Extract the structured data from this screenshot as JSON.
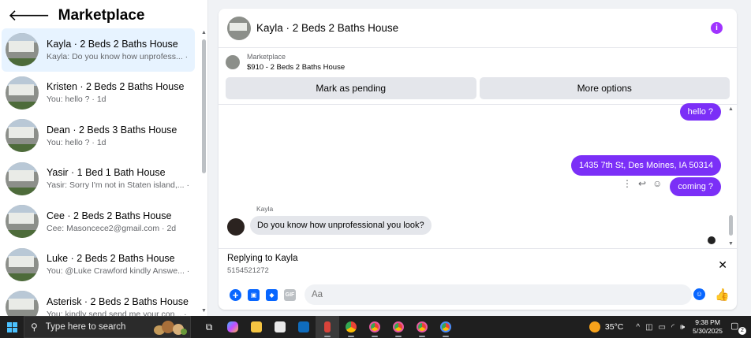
{
  "sidebar": {
    "title": "Marketplace",
    "conversations": [
      {
        "title": "Kayla · 2 Beds 2 Baths House",
        "preview": "Kayla: Do you know how unprofess... · 2h"
      },
      {
        "title": "Kristen · 2 Beds 2 Baths House",
        "preview": "You: hello ? · 1d"
      },
      {
        "title": "Dean · 2 Beds 3 Baths House",
        "preview": "You: hello ? · 1d"
      },
      {
        "title": "Yasir · 1 Bed 1 Bath House",
        "preview": "Yasir: Sorry I'm not in Staten island,... · 1d"
      },
      {
        "title": "Cee · 2 Beds 2 Baths House",
        "preview": "Cee: Masoncece2@gmail.com · 2d"
      },
      {
        "title": "Luke · 2 Beds 2 Baths House",
        "preview": "You: @Luke Crawford kindly Answe... · 6d"
      },
      {
        "title": "Asterisk · 2 Beds 2 Baths House",
        "preview": "You: kindly send send me your con... · 1w"
      }
    ]
  },
  "chat": {
    "title": "Kayla · 2 Beds 2 Baths House",
    "listing": {
      "label": "Marketplace",
      "price_line": "$910 - 2 Beds 2 Baths House"
    },
    "buttons": {
      "mark_pending": "Mark as pending",
      "more_options": "More options"
    },
    "messages": {
      "out_1": "hello ?",
      "out_2": "1435 7th St, Des Moines, IA 50314",
      "out_3": "coming ?",
      "sender": "Kayla",
      "in_1": "Do you know how unprofessional you look?"
    },
    "reply": {
      "title": "Replying to Kayla",
      "quoted": "5154521272"
    },
    "composer": {
      "placeholder": "Aa",
      "gif_label": "GIF"
    }
  },
  "taskbar": {
    "search_placeholder": "Type here to search",
    "temperature": "35°C",
    "time": "9:38 PM",
    "date": "5/30/2025",
    "notifications": "2"
  },
  "colors": {
    "accent": "#7b2ff7",
    "link_blue": "#0866ff",
    "info_purple": "#a033ff"
  }
}
